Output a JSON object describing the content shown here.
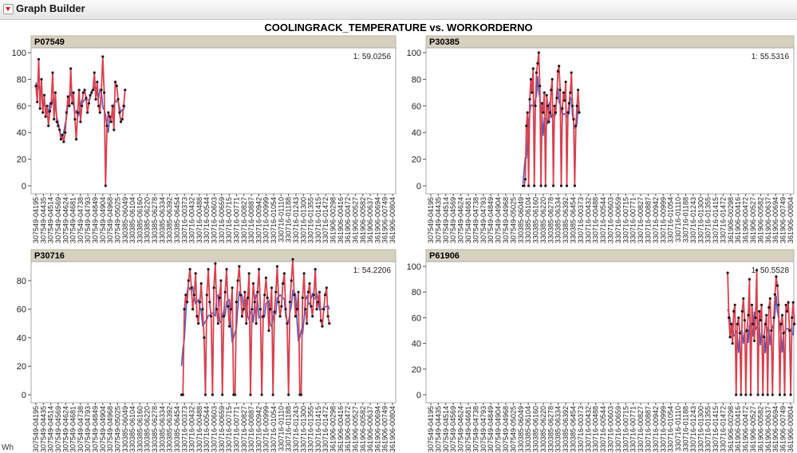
{
  "app": {
    "title": "Graph Builder"
  },
  "footnote": "Wh",
  "chart_data": [
    {
      "type": "line",
      "panel": "P07549",
      "title": "COOLINGRACK_TEMPERATURE vs. WORKORDERNO",
      "annotation": "1: 59.0256",
      "ylim": [
        0,
        100
      ],
      "yticks": [
        0,
        20,
        40,
        60,
        80,
        100
      ],
      "xlabels": [
        "307549-04195",
        "307549-04435",
        "307549-04514",
        "307549-04569",
        "307549-04624",
        "307549-04681",
        "307549-04738",
        "307549-04793",
        "307549-04849",
        "307549-04904",
        "307549-04968",
        "307549-05025",
        "330385-06049",
        "330385-06104",
        "330385-06160",
        "330385-06220",
        "330385-06278",
        "330385-06334",
        "330385-06392",
        "330385-06454",
        "330716-00373",
        "330716-00432",
        "330716-00488",
        "330716-00544",
        "330716-00603",
        "330716-00659",
        "330716-00715",
        "330716-00771",
        "330716-00827",
        "330716-00887",
        "330716-00942",
        "330716-00999",
        "330716-01054",
        "330716-01110",
        "330716-01188",
        "330716-01243",
        "330716-01300",
        "330716-01355",
        "330716-01415",
        "330716-01472",
        "361906-00298",
        "361906-00416",
        "361906-00472",
        "361906-00527",
        "361906-00582",
        "361906-00637",
        "361906-00694",
        "361906-00749",
        "361906-00804"
      ],
      "series": [
        {
          "x_range": [
            0,
            12
          ],
          "values": [
            75,
            63,
            95,
            58,
            80,
            55,
            68,
            52,
            60,
            45,
            56,
            62,
            85,
            50,
            70,
            48,
            45,
            42,
            35,
            38,
            33,
            40,
            55,
            67,
            60,
            88,
            62,
            70,
            50,
            35,
            55,
            72,
            48,
            60,
            70,
            72,
            66,
            55,
            62,
            68,
            70,
            72,
            85,
            65,
            78,
            60,
            55,
            72,
            97,
            70,
            0,
            45,
            55,
            52,
            48,
            60,
            42,
            78,
            75,
            65,
            55,
            48,
            50,
            60,
            72
          ]
        }
      ]
    },
    {
      "type": "line",
      "panel": "P30385",
      "annotation": "1: 55.5316",
      "ylim": [
        0,
        100
      ],
      "yticks": [
        0,
        20,
        40,
        60,
        80,
        100
      ],
      "xlabels": [
        "307549-04195",
        "307549-04435",
        "307549-04514",
        "307549-04569",
        "307549-04624",
        "307549-04681",
        "307549-04738",
        "307549-04793",
        "307549-04849",
        "307549-04904",
        "307549-04968",
        "307549-05025",
        "330385-06049",
        "330385-06104",
        "330385-06160",
        "330385-06220",
        "330385-06278",
        "330385-06334",
        "330385-06392",
        "330385-06454",
        "330716-00373",
        "330716-00432",
        "330716-00488",
        "330716-00544",
        "330716-00603",
        "330716-00659",
        "330716-00715",
        "330716-00771",
        "330716-00827",
        "330716-00887",
        "330716-00942",
        "330716-00999",
        "330716-01054",
        "330716-01110",
        "330716-01188",
        "330716-01243",
        "330716-01300",
        "330716-01355",
        "330716-01415",
        "330716-01472",
        "361906-00298",
        "361906-00416",
        "361906-00472",
        "361906-00527",
        "361906-00582",
        "361906-00637",
        "361906-00694",
        "361906-00749",
        "361906-00804"
      ],
      "series": [
        {
          "x_range": [
            12.3,
            19.8
          ],
          "values": [
            0,
            0,
            5,
            45,
            55,
            0,
            65,
            80,
            70,
            88,
            0,
            60,
            85,
            92,
            100,
            75,
            0,
            62,
            55,
            70,
            0,
            68,
            60,
            48,
            55,
            72,
            80,
            0,
            60,
            55,
            66,
            86,
            90,
            72,
            0,
            58,
            70,
            64,
            78,
            0,
            55,
            62,
            70,
            85,
            60,
            50,
            0,
            45,
            60,
            72,
            55
          ]
        }
      ]
    },
    {
      "type": "line",
      "panel": "P30716",
      "annotation": "1: 54.2206",
      "ylim": [
        0,
        90
      ],
      "yticks": [
        0,
        20,
        40,
        60,
        80
      ],
      "xlabels": [
        "307549-04195",
        "307549-04435",
        "307549-04514",
        "307549-04569",
        "307549-04624",
        "307549-04681",
        "307549-04738",
        "307549-04793",
        "307549-04849",
        "307549-04904",
        "307549-04968",
        "307549-05025",
        "330385-06049",
        "330385-06104",
        "330385-06160",
        "330385-06220",
        "330385-06278",
        "330385-06334",
        "330385-06392",
        "330385-06454",
        "330716-00373",
        "330716-00432",
        "330716-00488",
        "330716-00544",
        "330716-00603",
        "330716-00659",
        "330716-00715",
        "330716-00771",
        "330716-00827",
        "330716-00887",
        "330716-00942",
        "330716-00999",
        "330716-01054",
        "330716-01110",
        "330716-01188",
        "330716-01243",
        "330716-01300",
        "330716-01355",
        "330716-01415",
        "330716-01472",
        "361906-00298",
        "361906-00416",
        "361906-00472",
        "361906-00527",
        "361906-00582",
        "361906-00637",
        "361906-00694",
        "361906-00749",
        "361906-00804"
      ],
      "series": [
        {
          "x_range": [
            19.6,
            39.5
          ],
          "values": [
            0,
            0,
            60,
            70,
            65,
            80,
            88,
            75,
            60,
            70,
            85,
            55,
            50,
            65,
            78,
            60,
            40,
            0,
            70,
            88,
            65,
            55,
            0,
            75,
            92,
            60,
            50,
            68,
            80,
            0,
            55,
            72,
            88,
            62,
            48,
            60,
            75,
            0,
            0,
            65,
            80,
            90,
            70,
            55,
            60,
            72,
            50,
            68,
            85,
            0,
            60,
            78,
            65,
            50,
            72,
            88,
            60,
            0,
            55,
            70,
            82,
            68,
            45,
            60,
            75,
            0,
            58,
            72,
            90,
            65,
            55,
            62,
            78,
            85,
            60,
            50,
            0,
            65,
            80,
            95,
            70,
            55,
            60,
            72,
            0,
            0,
            68,
            85,
            60,
            50,
            72,
            78,
            62,
            55,
            70,
            88,
            60,
            65,
            72,
            52,
            48,
            60,
            70,
            75,
            55,
            50
          ]
        }
      ]
    },
    {
      "type": "line",
      "panel": "P61906",
      "annotation": "1: 50.5528",
      "ylim": [
        0,
        100
      ],
      "yticks": [
        0,
        20,
        40,
        60,
        80,
        100
      ],
      "xlabels": [
        "307549-04195",
        "307549-04435",
        "307549-04514",
        "307549-04569",
        "307549-04624",
        "307549-04681",
        "307549-04738",
        "307549-04793",
        "307549-04849",
        "307549-04904",
        "307549-04968",
        "307549-05025",
        "330385-06049",
        "330385-06104",
        "330385-06160",
        "330385-06220",
        "330385-06278",
        "330385-06334",
        "330385-06392",
        "330385-06454",
        "330716-00373",
        "330716-00432",
        "330716-00488",
        "330716-00544",
        "330716-00603",
        "330716-00659",
        "330716-00715",
        "330716-00771",
        "330716-00827",
        "330716-00887",
        "330716-00942",
        "330716-00999",
        "330716-01054",
        "330716-01110",
        "330716-01188",
        "330716-01243",
        "330716-01300",
        "330716-01355",
        "330716-01415",
        "330716-01472",
        "361906-00298",
        "361906-00416",
        "361906-00472",
        "361906-00527",
        "361906-00582",
        "361906-00637",
        "361906-00694",
        "361906-00749",
        "361906-00804"
      ],
      "series": [
        {
          "x_range": [
            39.6,
            48.5
          ],
          "values": [
            95,
            60,
            45,
            55,
            40,
            65,
            70,
            0,
            55,
            60,
            48,
            0,
            65,
            75,
            58,
            0,
            50,
            62,
            90,
            0,
            70,
            55,
            42,
            60,
            97,
            0,
            65,
            58,
            70,
            0,
            45,
            55,
            62,
            0,
            68,
            75,
            50,
            0,
            60,
            78,
            92,
            85,
            70,
            0,
            55,
            62,
            48,
            0,
            70,
            65,
            72,
            50,
            0,
            60,
            72,
            55
          ]
        }
      ]
    }
  ]
}
